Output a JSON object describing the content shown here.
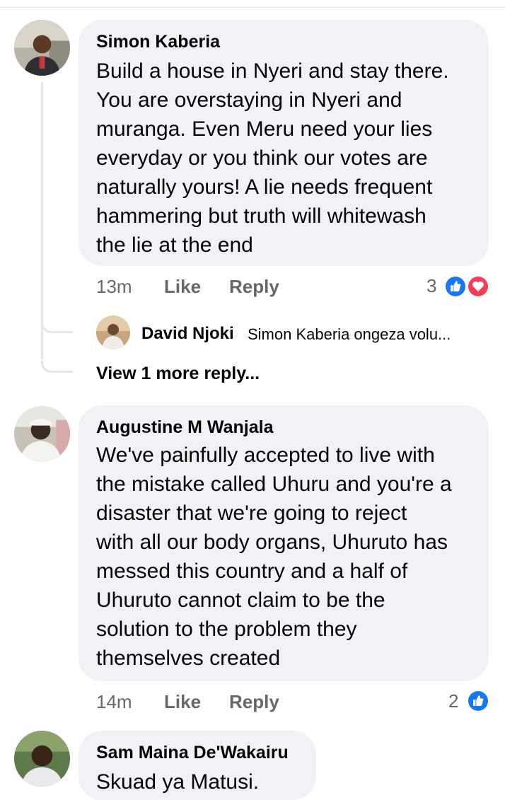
{
  "comments": [
    {
      "author": "Simon Kaberia",
      "lines": [
        "Build a house in Nyeri and stay there.",
        "You are overstaying in Nyeri and",
        "muranga. Even Meru need your lies",
        "everyday or you think our votes are",
        "naturally yours! A lie needs frequent",
        "hammering but truth will whitewash",
        "the lie at the end"
      ],
      "time": "13m",
      "like_label": "Like",
      "reply_label": "Reply",
      "reaction_count": "3",
      "reactions": [
        "like-icon",
        "love-icon"
      ],
      "reply": {
        "author": "David Njoki",
        "preview": "Simon Kaberia ongeza volu..."
      },
      "view_more": "View 1 more reply..."
    },
    {
      "author": "Augustine M Wanjala",
      "lines": [
        "We've painfully accepted to live with",
        "the mistake called Uhuru and you're a",
        "disaster that we're going to reject",
        "with all our body organs, Uhuruto has",
        "messed this country and a half of",
        "Uhuruto cannot claim to be the",
        "solution to the problem they",
        "themselves created"
      ],
      "time": "14m",
      "like_label": "Like",
      "reply_label": "Reply",
      "reaction_count": "2",
      "reactions": [
        "like-icon"
      ]
    },
    {
      "author": "Sam Maina De'Wakairu",
      "lines": [
        "Skuad ya Matusi."
      ]
    }
  ],
  "colors": {
    "bubble": "#f0f2f5",
    "meta": "#65676b",
    "like_blue": "#1877f2",
    "love_red": "#f33e58"
  }
}
